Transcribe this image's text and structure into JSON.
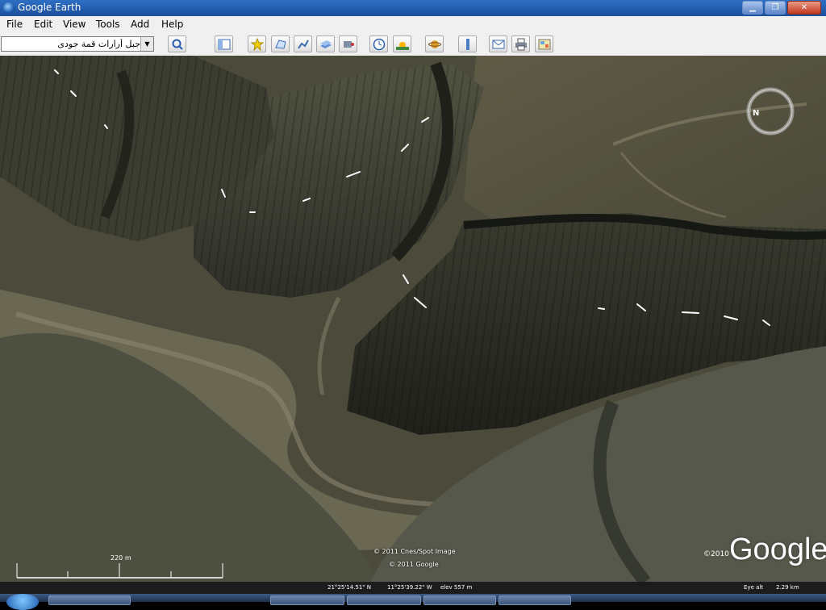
{
  "window": {
    "title": "Google Earth"
  },
  "menu": {
    "items": [
      "File",
      "Edit",
      "View",
      "Tools",
      "Add",
      "Help"
    ]
  },
  "search": {
    "value": "جبل أرارات قمة جودى"
  },
  "toolbar": {
    "icons": [
      "search-icon",
      "sidebar-toggle-icon",
      "placemark-icon",
      "polygon-icon",
      "path-icon",
      "overlay-icon",
      "record-tour-icon",
      "historical-imagery-icon",
      "sunlight-icon",
      "planets-icon",
      "ruler-icon",
      "email-icon",
      "print-icon",
      "view-in-maps-icon"
    ]
  },
  "map": {
    "credit_1": "© 2011 Cnes/Spot Image",
    "credit_2": "© 2011 Google",
    "copyright_year": "©2010",
    "logo": "Google",
    "scale_label": "220 m"
  },
  "status": {
    "lat": "21°25'14.51\" N",
    "lon": "11°25'39.22\" W",
    "elev": "elev  557 m",
    "eye_alt_label": "Eye alt",
    "eye_alt_value": "2.29 km"
  },
  "colors": {
    "titlebar": "#1b4f9c",
    "terrain_dark": "#2a2c22",
    "terrain_light": "#6c6956"
  }
}
